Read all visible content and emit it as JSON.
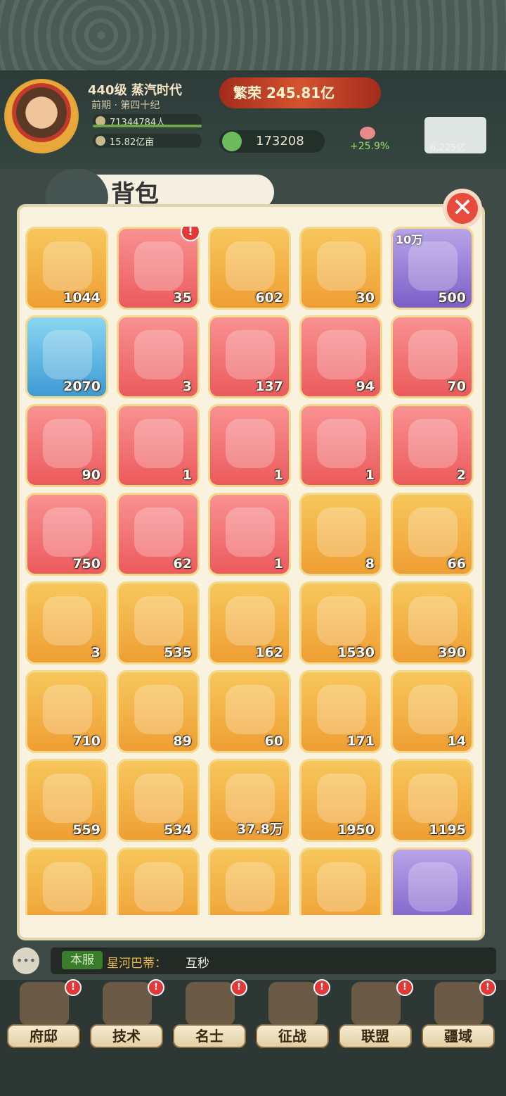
{
  "player": {
    "level_era": "440级 蒸汽时代",
    "period": "前期 · 第四十纪",
    "population": "71344784人",
    "land": "15.82亿亩"
  },
  "prosperity": {
    "label": "繁荣",
    "value": "245.81亿"
  },
  "gold": {
    "value": "173208"
  },
  "growth": "+25.9%",
  "right_resource": "6.225亿",
  "bag": {
    "title": "背包",
    "close_icon": "close-icon",
    "items": [
      {
        "icon": "tongbao-coin-icon",
        "count": "1044",
        "bg": "orange"
      },
      {
        "icon": "treasure-chest-icon",
        "count": "35",
        "bg": "red",
        "alert": "!"
      },
      {
        "icon": "blue-scroll-icon",
        "count": "602",
        "bg": "orange"
      },
      {
        "icon": "land-deed-icon",
        "count": "30",
        "bg": "orange"
      },
      {
        "icon": "coffee-beans-icon",
        "count": "500",
        "bg": "purple",
        "tag": "10万"
      },
      {
        "icon": "blue-card-icon",
        "count": "2070",
        "bg": "blue"
      },
      {
        "icon": "jade-seal-icon",
        "count": "3",
        "bg": "red"
      },
      {
        "icon": "armor-plates-icon",
        "count": "137",
        "bg": "red"
      },
      {
        "icon": "warrior-scroll-icon",
        "count": "94",
        "bg": "red"
      },
      {
        "icon": "crossbow-scroll-icon",
        "count": "70",
        "bg": "red"
      },
      {
        "icon": "flute-scroll-icon",
        "count": "90",
        "bg": "red"
      },
      {
        "icon": "soldier-scroll-icon",
        "count": "1",
        "bg": "red"
      },
      {
        "icon": "flute-scroll-icon",
        "count": "1",
        "bg": "red"
      },
      {
        "icon": "gear-orb-icon",
        "count": "1",
        "bg": "red"
      },
      {
        "icon": "green-gear-icon",
        "count": "2",
        "bg": "red"
      },
      {
        "icon": "golden-swirl-icon",
        "count": "750",
        "bg": "red"
      },
      {
        "icon": "jade-ring-icon",
        "count": "62",
        "bg": "red"
      },
      {
        "icon": "change-card-icon",
        "count": "1",
        "bg": "red"
      },
      {
        "icon": "feather-icon",
        "count": "8",
        "bg": "orange"
      },
      {
        "icon": "log-icon",
        "count": "66",
        "bg": "orange"
      },
      {
        "icon": "flower-icon",
        "count": "3",
        "bg": "orange"
      },
      {
        "icon": "hourglass-icon",
        "count": "535",
        "bg": "orange"
      },
      {
        "icon": "papers-icon",
        "count": "162",
        "bg": "orange"
      },
      {
        "icon": "ore-icon",
        "count": "1530",
        "bg": "orange"
      },
      {
        "icon": "jade-disc-icon",
        "count": "390",
        "bg": "orange"
      },
      {
        "icon": "rope-coil-icon",
        "count": "710",
        "bg": "orange"
      },
      {
        "icon": "whip-icon",
        "count": "89",
        "bg": "orange"
      },
      {
        "icon": "white-stone-icon",
        "count": "60",
        "bg": "orange"
      },
      {
        "icon": "gold-nugget-icon",
        "count": "171",
        "bg": "orange"
      },
      {
        "icon": "compass-icon",
        "count": "14",
        "bg": "orange"
      },
      {
        "icon": "cat-statue-icon",
        "count": "559",
        "bg": "orange"
      },
      {
        "icon": "bun-icon",
        "count": "534",
        "bg": "orange"
      },
      {
        "icon": "red-gem-icon",
        "count": "37.8万",
        "bg": "orange"
      },
      {
        "icon": "token-icon",
        "count": "1950",
        "bg": "orange"
      },
      {
        "icon": "welcome-card-icon",
        "count": "1195",
        "bg": "orange"
      },
      {
        "icon": "visit-card-icon",
        "count": "",
        "bg": "orange"
      },
      {
        "icon": "palette-icon",
        "count": "",
        "bg": "orange"
      },
      {
        "icon": "fan-icon",
        "count": "",
        "bg": "orange"
      },
      {
        "icon": "bronze-beast-icon",
        "count": "",
        "bg": "orange"
      },
      {
        "icon": "dark-crystal-icon",
        "count": "",
        "bg": "purple"
      }
    ]
  },
  "chat": {
    "channel": "本服",
    "sender": "星河巴蒂：",
    "message": "互秒"
  },
  "nav": [
    {
      "label": "府邸",
      "icon": "mansion-icon"
    },
    {
      "label": "技术",
      "icon": "technology-icon"
    },
    {
      "label": "名士",
      "icon": "scholar-icon"
    },
    {
      "label": "征战",
      "icon": "battle-icon"
    },
    {
      "label": "联盟",
      "icon": "alliance-icon"
    },
    {
      "label": "疆域",
      "icon": "territory-icon"
    }
  ]
}
